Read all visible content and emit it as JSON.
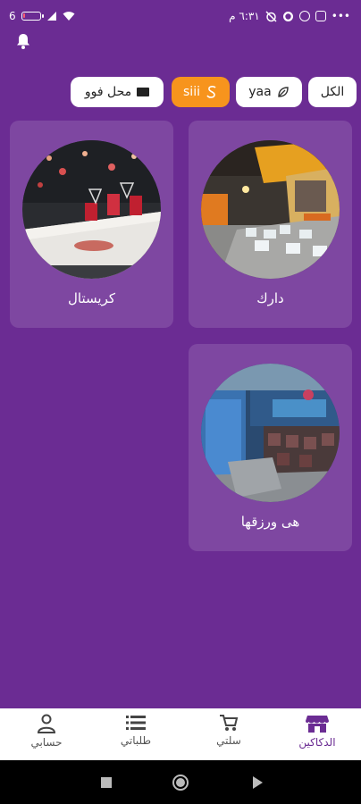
{
  "status_bar": {
    "signal_text": "6",
    "time": "٦:٣١ م",
    "dots": "•••",
    "battery_level": 0.12
  },
  "filters": [
    {
      "label": "الكل",
      "icon": "",
      "active": false
    },
    {
      "label": "yaa",
      "icon": "leaf-icon",
      "active": false
    },
    {
      "label": "siii",
      "icon": "s-logo-icon",
      "active": true
    },
    {
      "label": "محل فوو",
      "icon": "card-icon",
      "active": false
    }
  ],
  "stores": [
    {
      "name": "دارك"
    },
    {
      "name": "كريستال"
    },
    {
      "name": "هى ورزقها"
    }
  ],
  "bottom_nav": [
    {
      "label": "الدكاكين",
      "icon": "store-icon",
      "active": true
    },
    {
      "label": "سلتي",
      "icon": "cart-icon",
      "active": false
    },
    {
      "label": "طلباتي",
      "icon": "list-icon",
      "active": false
    },
    {
      "label": "حسابي",
      "icon": "user-icon",
      "active": false
    }
  ],
  "colors": {
    "background": "#6b2c93",
    "accent": "#f7941d",
    "card": "#7f46a3",
    "nav_active": "#6b2c93"
  }
}
